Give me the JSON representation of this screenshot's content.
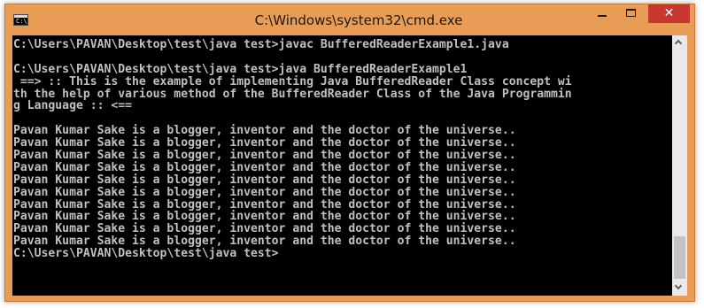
{
  "window": {
    "title": "C:\\Windows\\system32\\cmd.exe",
    "icon_label": "C:\\",
    "controls": {
      "minimize": "minimize-icon",
      "maximize": "maximize-icon",
      "close": "✕"
    },
    "accent_color": "#e99c55",
    "close_color": "#c7372f"
  },
  "console": {
    "background": "#000000",
    "foreground": "#c0c0c0",
    "lines": [
      "C:\\Users\\PAVAN\\Desktop\\test\\java test>javac BufferedReaderExample1.java",
      "",
      "C:\\Users\\PAVAN\\Desktop\\test\\java test>java BufferedReaderExample1",
      " ==> :: This is the example of implementing Java BufferedReader Class concept wi",
      "th the help of various method of the BufferedReader Class of the Java Programmin",
      "g Language :: <==",
      "",
      "Pavan Kumar Sake is a blogger, inventor and the doctor of the universe..",
      "Pavan Kumar Sake is a blogger, inventor and the doctor of the universe..",
      "Pavan Kumar Sake is a blogger, inventor and the doctor of the universe..",
      "Pavan Kumar Sake is a blogger, inventor and the doctor of the universe..",
      "Pavan Kumar Sake is a blogger, inventor and the doctor of the universe..",
      "Pavan Kumar Sake is a blogger, inventor and the doctor of the universe..",
      "Pavan Kumar Sake is a blogger, inventor and the doctor of the universe..",
      "Pavan Kumar Sake is a blogger, inventor and the doctor of the universe..",
      "Pavan Kumar Sake is a blogger, inventor and the doctor of the universe..",
      "Pavan Kumar Sake is a blogger, inventor and the doctor of the universe..",
      "C:\\Users\\PAVAN\\Desktop\\test\\java test>"
    ]
  },
  "scrollbar": {
    "up_icon": "chevron-up-icon",
    "down_icon": "chevron-down-icon"
  }
}
